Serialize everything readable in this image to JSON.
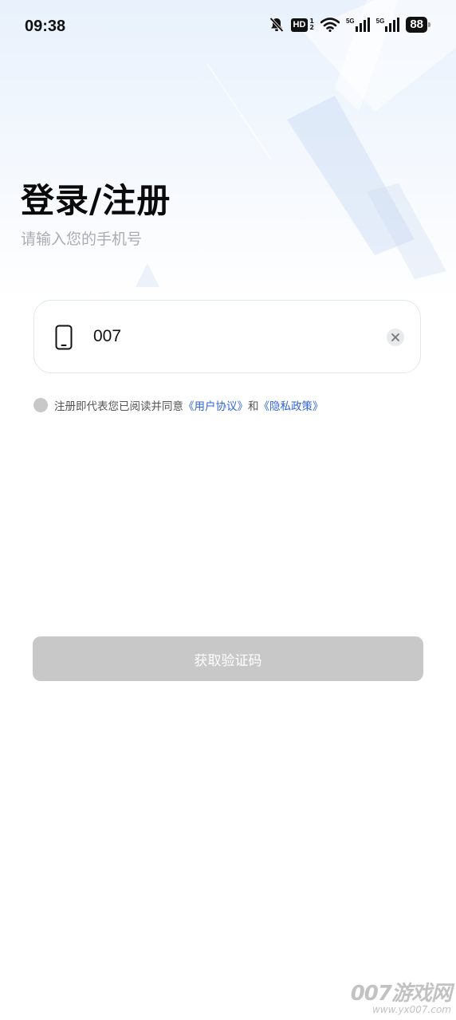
{
  "status_bar": {
    "time": "09:38",
    "hd_label": "HD",
    "hd_sup_top": "1",
    "hd_sup_bottom": "2",
    "net1_label": "5G",
    "net2_label": "5G",
    "battery": "88",
    "icons": [
      "bell-off-icon",
      "wifi-icon",
      "signal-icon",
      "signal-icon"
    ]
  },
  "header": {
    "title": "登录/注册",
    "subtitle": "请输入您的手机号"
  },
  "phone_input": {
    "value": "007",
    "icon": "phone-icon",
    "clear_icon": "clear-icon"
  },
  "agreement": {
    "prefix": "注册即代表您已阅读并同意",
    "user_agreement": "《用户协议》",
    "and": "和",
    "privacy_policy": "《隐私政策》",
    "checked": false
  },
  "get_code_button": {
    "label": "获取验证码",
    "enabled": false
  },
  "watermark": {
    "main": "007游戏网",
    "url": "www.yx007.com"
  },
  "colors": {
    "link": "#2f64d8",
    "button_disabled": "#c8c8c8",
    "subtitle": "#a9adb3"
  }
}
